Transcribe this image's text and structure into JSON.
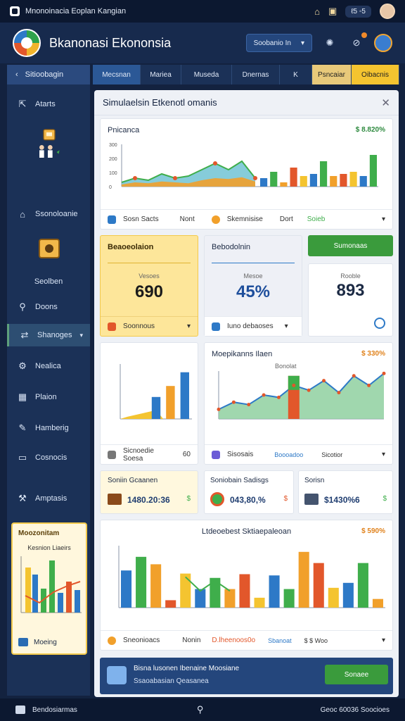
{
  "status_bar": {
    "title": "Mnonoinacia Eoplan Kangian",
    "chip": "ℓ5 ◦5"
  },
  "header": {
    "app_title": "Bkanonasi Ekononsia",
    "select_label": "Soobanio In"
  },
  "sidebar": {
    "back_label": "Sitioobagin",
    "items": [
      {
        "label": "Atarts",
        "icon": "chart-icon"
      },
      {
        "label": "Ssonoloanie",
        "icon": "home-icon"
      },
      {
        "label": "Seolben",
        "icon": "clipboard-icon"
      },
      {
        "label": "Doons",
        "icon": "search-icon"
      },
      {
        "label": "Shanoges",
        "icon": "exchange-icon"
      },
      {
        "label": "Nealica",
        "icon": "gear-icon"
      },
      {
        "label": "Plaion",
        "icon": "grid-icon"
      },
      {
        "label": "Hamberig",
        "icon": "pen-icon"
      },
      {
        "label": "Cosnocis",
        "icon": "monitor-icon"
      },
      {
        "label": "Amptasis",
        "icon": "tool-icon"
      }
    ],
    "card": {
      "title": "Moozonitam",
      "subtitle": "Kesnion Liaeirs",
      "footer": "Moeing"
    }
  },
  "tabs": [
    "Mecsnan",
    "Mariea",
    "Museda",
    "Dnernas",
    "K",
    "Psncaiar",
    "Oibacnis"
  ],
  "main": {
    "title": "Simulaelsin Etkenotl omanis",
    "top_chart": {
      "title": "Pnicanca",
      "pct": "$ 8.820%",
      "foot": [
        "Sosn Sacts",
        "Nont",
        "Skemnisise",
        "Dort",
        "Soieb"
      ]
    },
    "stat1": {
      "header": "Beaoeolaion",
      "label": "Vesoes",
      "value": "690",
      "foot": "Soonnous"
    },
    "stat2": {
      "header": "Bebodolnin",
      "label": "Mesoe",
      "value": "45%",
      "foot": "Iuno debaoses"
    },
    "stat3": {
      "label": "Rooble",
      "value": "893",
      "button": "Sumonaas"
    },
    "mid_left_chart": {
      "foot": [
        "Sicnoedie Soesa",
        "60"
      ]
    },
    "mid_right_chart": {
      "title": "Moepikanns Ilaen",
      "pct": "$ 330%",
      "subtitle": "Bonolat",
      "foot": [
        "Sisosais",
        "Boooadoo",
        "Sicotior"
      ]
    },
    "mini1": {
      "label": "Soniin Gcaanen",
      "value": "1480.20:36",
      "arrow": "$"
    },
    "mini2": {
      "label": "Soniobain Sadisgs",
      "value": "043,80,%",
      "arrow": "$"
    },
    "mini3": {
      "label": "Sorisn",
      "value": "$1430%6",
      "arrow": "$"
    },
    "bottom_chart": {
      "title": "Ltdeoebest Sktiaepaleoan",
      "pct": "$ 590%",
      "foot": [
        "Sneonioacs",
        "Nonin",
        "D.lheenoos0o",
        "Sbanoat",
        "$ $ Woo"
      ]
    },
    "banner": {
      "line1": "Bisna lusonen Ibenaine Moosiane",
      "line2": "Ssaoabasian Qeasanea",
      "button": "Sonaee"
    }
  },
  "bottom_bar": {
    "left": "Bendosiarmas",
    "right": "Geoc 60036 Soocioes"
  },
  "colors": {
    "blue": "#2d79c7",
    "green": "#3fae4b",
    "orange": "#f1a02b",
    "red": "#e2572b",
    "yellow": "#f4c430"
  },
  "chart_data": [
    {
      "type": "area",
      "title": "Pnicanca",
      "ylim": [
        0,
        100
      ],
      "ytick_labels": [
        "0",
        "100",
        "200",
        "300"
      ],
      "series": [
        {
          "values": [
            10,
            20,
            15,
            30,
            20,
            25,
            40,
            55,
            40,
            60,
            20
          ]
        },
        {
          "values": [
            5,
            10,
            8,
            12,
            10,
            8,
            15,
            20,
            18,
            22,
            12
          ]
        }
      ],
      "bars": [
        20,
        35,
        10,
        45,
        25,
        30,
        60,
        25,
        30,
        35,
        25,
        75
      ]
    },
    {
      "type": "bar",
      "ylim": [
        0,
        100
      ],
      "values": [
        10,
        25,
        40,
        60,
        85
      ]
    },
    {
      "type": "line",
      "title": "Moepikanns Ilaen",
      "series": [
        {
          "values": [
            20,
            35,
            30,
            50,
            45,
            70,
            60,
            80,
            55,
            90,
            70,
            95
          ]
        }
      ]
    },
    {
      "type": "bar",
      "title": "Ltdeoebest Sktiaepaleoan",
      "ylim": [
        0,
        100
      ],
      "values": [
        60,
        82,
        70,
        12,
        55,
        30,
        48,
        30,
        54,
        16,
        52,
        30,
        90,
        72,
        32,
        40,
        72,
        14
      ]
    }
  ]
}
